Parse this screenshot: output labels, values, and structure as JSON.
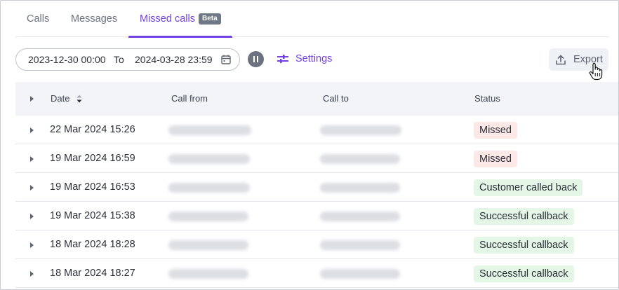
{
  "tabs": [
    {
      "label": "Calls"
    },
    {
      "label": "Messages"
    },
    {
      "label": "Missed calls",
      "badge": "Beta",
      "active": true
    }
  ],
  "toolbar": {
    "from": "2023-12-30 00:00",
    "to_label": "To",
    "to": "2024-03-28 23:59",
    "settings_label": "Settings",
    "export_label": "Export"
  },
  "table": {
    "headers": {
      "date": "Date",
      "call_from": "Call from",
      "call_to": "Call to",
      "status": "Status"
    },
    "rows": [
      {
        "date": "22 Mar 2024 15:26",
        "status": "Missed",
        "status_type": "missed"
      },
      {
        "date": "19 Mar 2024 16:59",
        "status": "Missed",
        "status_type": "missed"
      },
      {
        "date": "19 Mar 2024 16:53",
        "status": "Customer called back",
        "status_type": "success"
      },
      {
        "date": "19 Mar 2024 15:38",
        "status": "Successful callback",
        "status_type": "success"
      },
      {
        "date": "18 Mar 2024 18:28",
        "status": "Successful callback",
        "status_type": "success"
      },
      {
        "date": "18 Mar 2024 18:27",
        "status": "Successful callback",
        "status_type": "success"
      }
    ]
  },
  "colors": {
    "accent": "#7340e6",
    "missed_bg": "#fde8e8",
    "success_bg": "#e4f6e6"
  },
  "icons": [
    "calendar-icon",
    "pause-icon",
    "settings-sliders-icon",
    "upload-icon",
    "sort-icon",
    "expand-caret-icon",
    "hand-cursor-icon"
  ]
}
